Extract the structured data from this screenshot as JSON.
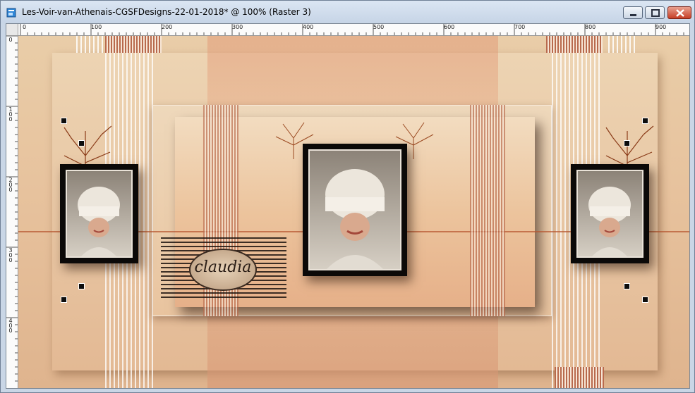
{
  "window": {
    "title": "Les-Voir-van-Athenais-CGSFDesigns-22-01-2018* @ 100% (Raster 3)",
    "buttons": {
      "minimize_icon": "minimize-icon",
      "maximize_icon": "maximize-icon",
      "close_icon": "close-icon"
    }
  },
  "ruler": {
    "top_labels": [
      "0",
      "100",
      "200",
      "300",
      "400",
      "500",
      "600",
      "700",
      "800",
      "900"
    ],
    "left_labels": [
      "0",
      "1\n0\n0",
      "2\n0\n0",
      "3\n0\n0",
      "4\n0\n0"
    ]
  },
  "canvas": {
    "watermark_text": "claudia",
    "colors": {
      "background": "#e7c29d",
      "frame": "#0b0908",
      "accent_stripe": "#b86a4d"
    }
  }
}
